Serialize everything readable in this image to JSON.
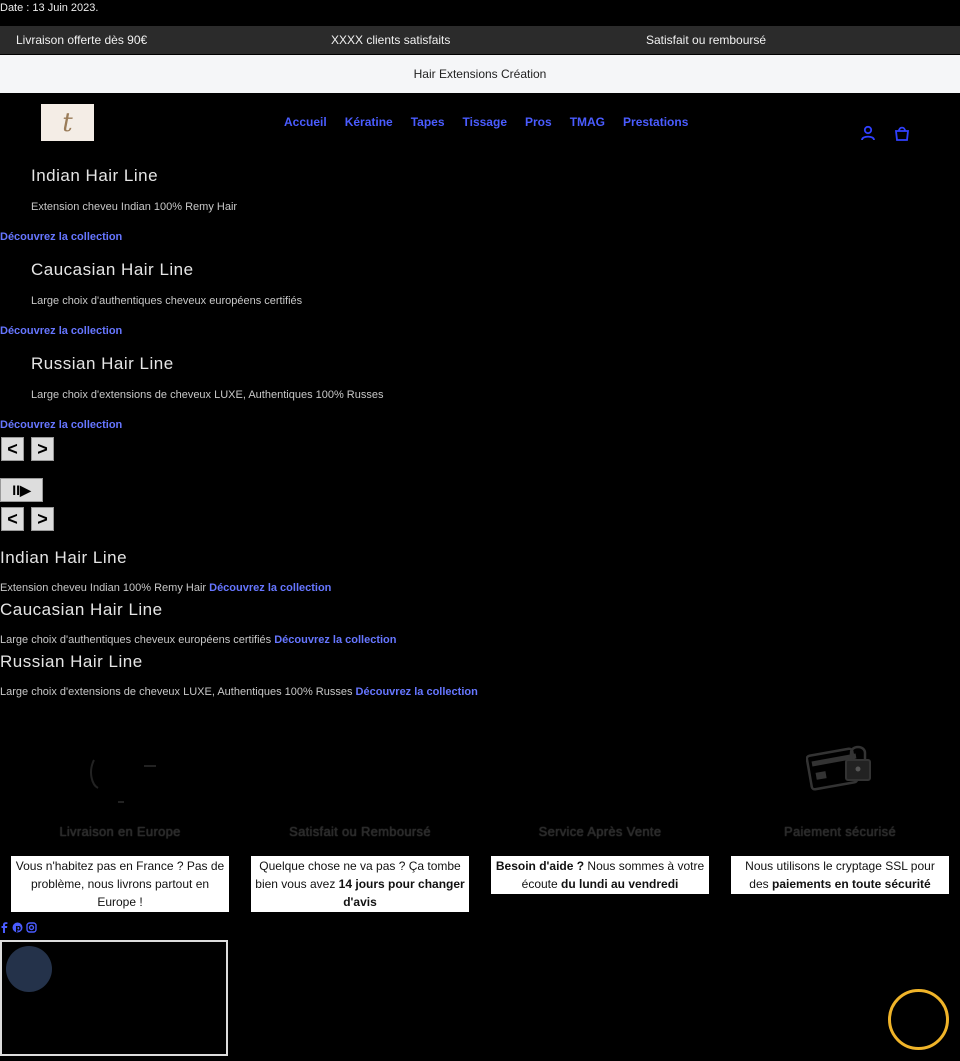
{
  "date_bar": "Date : 13 Juin 2023.",
  "promo": {
    "left": "Livraison offerte dès 90€",
    "center": "XXXX clients satisfaits",
    "right": "Satisfait ou remboursé"
  },
  "announcement": "Hair Extensions Création",
  "logo_letter": "t",
  "nav": [
    "Accueil",
    "Kératine",
    "Tapes",
    "Tissage",
    "Pros",
    "TMAG",
    "Prestations"
  ],
  "slides": [
    {
      "title": "Indian Hair Line",
      "text": "Extension cheveu Indian 100% Remy Hair",
      "link": "Découvrez la collection"
    },
    {
      "title": "Caucasian Hair Line",
      "text": "Large choix d'authentiques cheveux européens certifiés",
      "link": "Découvrez la collection"
    },
    {
      "title": "Russian Hair Line",
      "text": "Large choix d'extensions de cheveux LUXE, Authentiques 100% Russes",
      "link": "Découvrez la collection"
    }
  ],
  "controls": {
    "prev": "<",
    "next": ">",
    "play_pause": "II▶"
  },
  "rows": [
    {
      "title": "Indian Hair Line",
      "text": "Extension cheveu Indian 100% Remy Hair ",
      "link": "Découvrez la collection"
    },
    {
      "title": "Caucasian Hair Line",
      "text": "Large choix d'authentiques cheveux européens certifiés ",
      "link": "Découvrez la collection"
    },
    {
      "title": "Russian Hair Line",
      "text": "Large choix d'extensions de cheveux LUXE, Authentiques 100% Russes ",
      "link": "Découvrez la collection"
    }
  ],
  "features": [
    {
      "title": "Livraison en Europe",
      "pre": "Vous n'habitez pas en France ? Pas de problème, nous livrons partout en Europe !",
      "bold": "",
      "post": ""
    },
    {
      "title": "Satisfait ou Remboursé",
      "pre": "Quelque chose ne va pas ? Ça tombe bien vous avez ",
      "bold": "14 jours pour changer d'avis",
      "post": ""
    },
    {
      "title": "Service Après Vente",
      "pre": "",
      "bold": "Besoin d'aide ?",
      "post": " Nous sommes à votre écoute ",
      "bold2": "du lundi au vendredi"
    },
    {
      "title": "Paiement sécurisé",
      "pre": "Nous utilisons le cryptage SSL pour des ",
      "bold": "paiements en toute sécurité",
      "post": ""
    }
  ],
  "icons": {
    "account": "user-icon",
    "cart": "bag-icon",
    "social": [
      "facebook-icon",
      "pinterest-icon",
      "instagram-icon"
    ]
  },
  "colors": {
    "nav": "#4a5cff",
    "promo_bg": "#2b2b2b",
    "announce_bg": "#f5f6f8",
    "chat_ring": "#f0b429"
  }
}
